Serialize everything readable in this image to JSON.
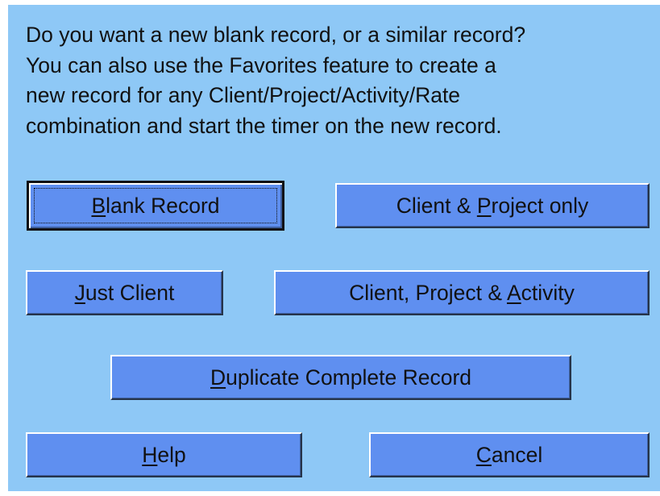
{
  "dialog": {
    "message_lines": [
      "Do you want a new blank record, or a similar record?",
      "You can also use the Favorites feature to create a",
      "new record for any Client/Project/Activity/Rate",
      "combination and start the timer on the new record."
    ],
    "colors": {
      "background": "#8ec8f6",
      "button": "#5f8ff0",
      "text": "#111111"
    }
  },
  "buttons": {
    "blank_record": {
      "pre": "",
      "mnemonic": "B",
      "post": "lank Record"
    },
    "client_project_only": {
      "pre": "Client & ",
      "mnemonic": "P",
      "post": "roject only"
    },
    "just_client": {
      "pre": "",
      "mnemonic": "J",
      "post": "ust Client"
    },
    "client_project_activity": {
      "pre": "Client, Project & ",
      "mnemonic": "A",
      "post": "ctivity"
    },
    "duplicate_complete": {
      "pre": "",
      "mnemonic": "D",
      "post": "uplicate Complete Record"
    },
    "help": {
      "pre": "",
      "mnemonic": "H",
      "post": "elp"
    },
    "cancel": {
      "pre": "",
      "mnemonic": "C",
      "post": "ancel"
    }
  }
}
